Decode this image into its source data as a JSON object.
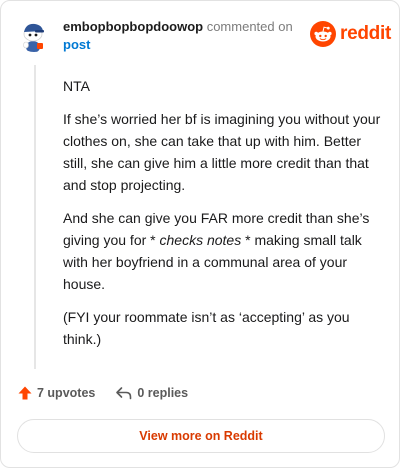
{
  "header": {
    "username": "embopbopbopdoowop",
    "commented_text": "commented on",
    "post_link": "post",
    "brand": "reddit"
  },
  "comment": {
    "p1": "NTA",
    "p2": "If she’s worried her bf is imagining you without your clothes on, she can take that up with him. Better still, she can give him a little more credit than that and stop projecting.",
    "p3_before": "And she can give you FAR more credit than she’s giving you for * ",
    "p3_emphasis": "checks notes",
    "p3_after": " * making small talk with her boyfriend in a communal area of your house.",
    "p4": "(FYI your roommate isn’t as ‘accepting’ as you think.)"
  },
  "actions": {
    "upvotes": "7 upvotes",
    "replies": "0 replies"
  },
  "footer": {
    "view_more": "View more on Reddit"
  },
  "colors": {
    "brand": "#ff4500",
    "link": "#0079d3",
    "view_more": "#d93a00"
  },
  "icons": {
    "avatar": "snoo-avatar-icon",
    "logo": "reddit-logo-icon",
    "upvote": "upvote-arrow-icon",
    "reply": "reply-arrow-icon"
  }
}
